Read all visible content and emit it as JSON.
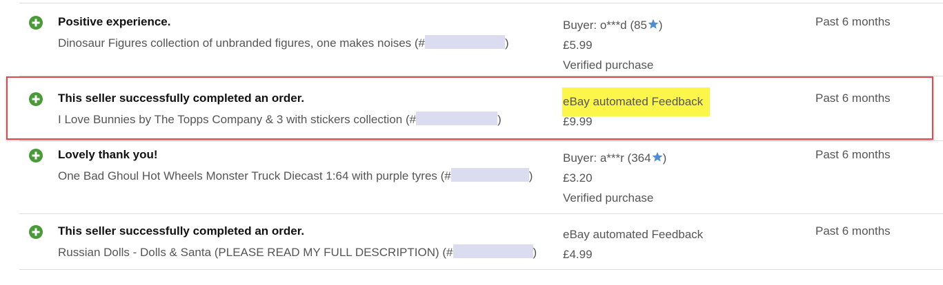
{
  "colors": {
    "positive_icon": "#4a9a3a",
    "star": "#4f8fd0",
    "highlight": "#fdf64a",
    "callout_border": "#e0494b",
    "redaction": "#dcdcf0"
  },
  "icons": {
    "positive": "plus-circle-icon",
    "rating": "star-icon"
  },
  "rows": [
    {
      "comment": "Positive experience.",
      "item_prefix": "Dinosaur Figures collection of unbranded figures, one makes noises (#",
      "item_suffix": ")",
      "buyer_prefix": "Buyer: o***d (85",
      "buyer_suffix": ")",
      "price": "£5.99",
      "verified": "Verified purchase",
      "time": "Past 6 months"
    },
    {
      "comment": "This seller successfully completed an order.",
      "item_prefix": "I Love Bunnies by The Topps Company & 3 with stickers collection (#",
      "item_suffix": ")",
      "source": "eBay automated Feedback",
      "price": "£9.99",
      "time": "Past 6 months"
    },
    {
      "comment": "Lovely thank you!",
      "item_prefix": "One Bad Ghoul Hot Wheels Monster Truck Diecast 1:64 with purple tyres (#",
      "item_suffix": ")",
      "buyer_prefix": "Buyer: a***r (364",
      "buyer_suffix": ")",
      "price": "£3.20",
      "verified": "Verified purchase",
      "time": "Past 6 months"
    },
    {
      "comment": "This seller successfully completed an order.",
      "item_prefix": "Russian Dolls - Dolls & Santa (PLEASE READ MY FULL DESCRIPTION) (#",
      "item_suffix": ")",
      "source": "eBay automated Feedback",
      "price": "£4.99",
      "time": "Past 6 months"
    }
  ]
}
